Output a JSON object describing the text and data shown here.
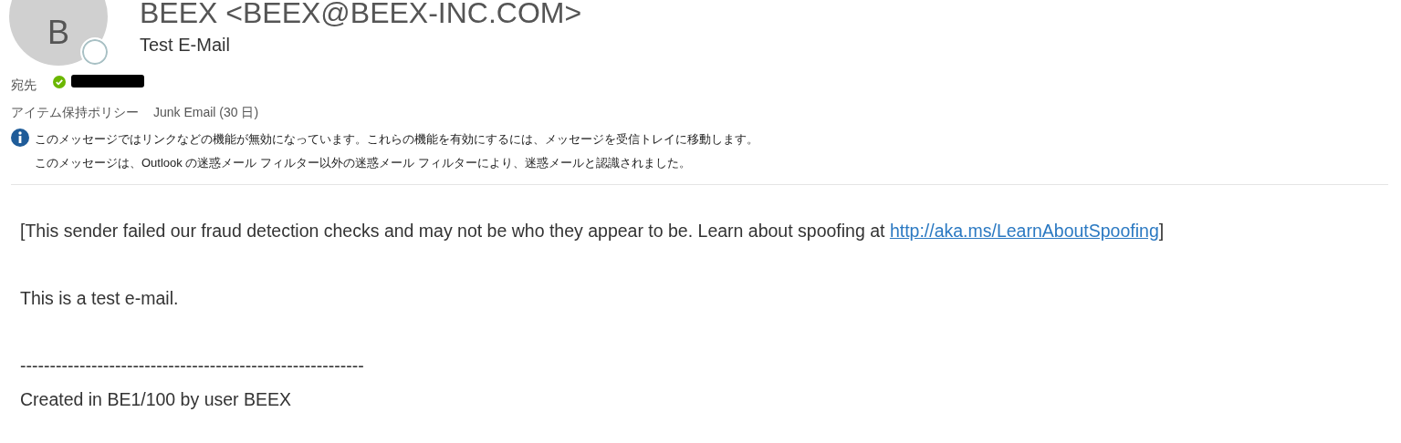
{
  "header": {
    "avatar_letter": "B",
    "presence_online": false,
    "sender": "BEEX <BEEX@BEEX-INC.COM>",
    "subject": "Test E-Mail"
  },
  "recipients": {
    "label": "宛先",
    "verified": true,
    "redacted": true
  },
  "retention": {
    "label": "アイテム保持ポリシー",
    "value": "Junk Email (30 日)"
  },
  "info_bar": {
    "lines": [
      "このメッセージではリンクなどの機能が無効になっています。これらの機能を有効にするには、メッセージを受信トレイに移動します。",
      "このメッセージは、Outlook の迷惑メール フィルター以外の迷惑メール フィルターにより、迷惑メールと認識されました。"
    ]
  },
  "body": {
    "warning": {
      "before": "[This sender failed our fraud detection checks and may not be who they appear to be. Learn about spoofing at ",
      "link": "http://aka.ms/LearnAboutSpoofing",
      "after": "]"
    },
    "paragraphs": [
      "This is a test e-mail.",
      "----------------------------------------------------------",
      "Created in BE1/100 by user BEEX"
    ]
  }
}
